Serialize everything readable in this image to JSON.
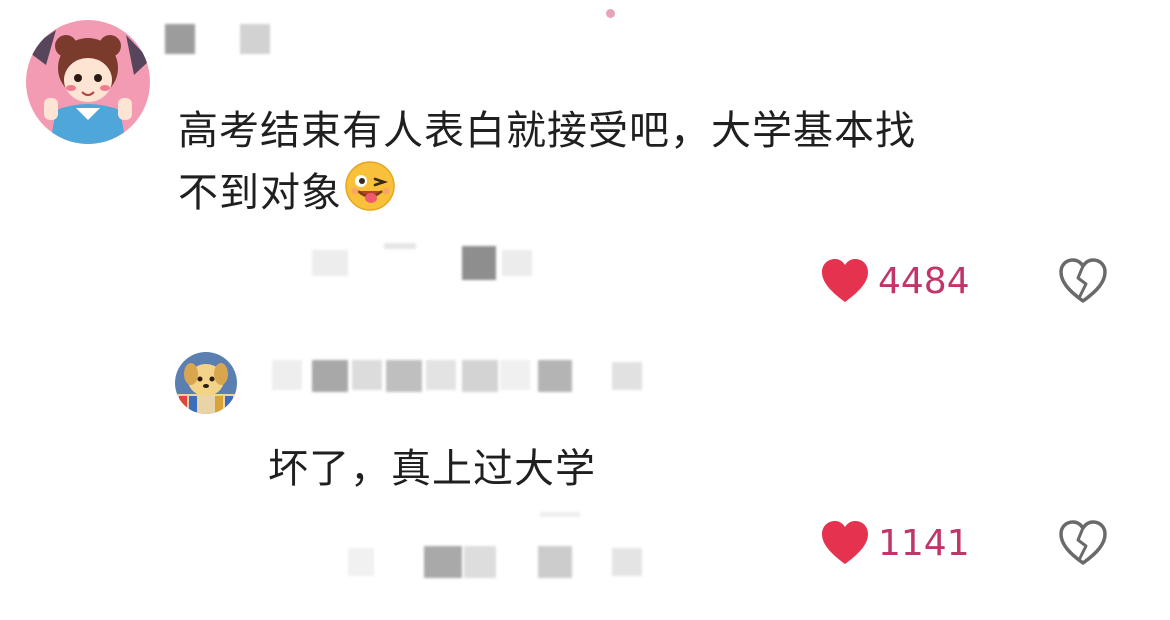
{
  "comment": {
    "text_line1": "高考结束有人表白就接受吧，大学基本找",
    "text_line2": "不到对象",
    "emoji_icon": "wink-tongue-emoji",
    "like_count": "4484",
    "avatar_icon": "cartoon-girl-avatar"
  },
  "reply": {
    "text": "坏了，真上过大学",
    "like_count": "1141",
    "avatar_icon": "cartoon-dog-avatar"
  },
  "colors": {
    "heart": "#e5334f",
    "count": "#c0356a",
    "text": "#1f1f1f",
    "dislike_icon": "#6a6a6a"
  }
}
